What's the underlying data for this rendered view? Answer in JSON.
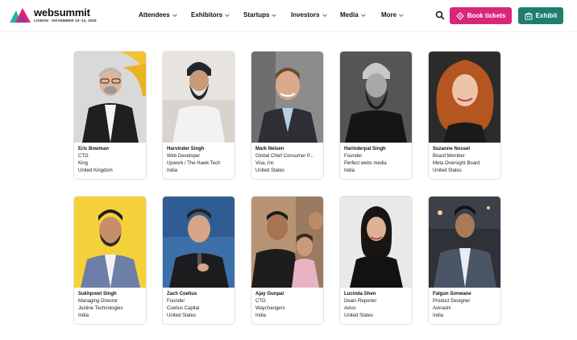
{
  "header": {
    "logo_text": "websummit",
    "logo_sub": "LISBON · NOVEMBER 10–13, 2025",
    "nav": [
      {
        "label": "Attendees",
        "has_dropdown": true
      },
      {
        "label": "Exhibitors",
        "has_dropdown": true
      },
      {
        "label": "Startups",
        "has_dropdown": true
      },
      {
        "label": "Investors",
        "has_dropdown": true
      },
      {
        "label": "Media",
        "has_dropdown": true
      },
      {
        "label": "More",
        "has_dropdown": true
      }
    ],
    "search_icon": "search-icon",
    "book_label": "Book tickets",
    "exhibit_label": "Exhibit",
    "colors": {
      "book": "#d9267a",
      "exhibit": "#1e7f6f",
      "chevron": "#1e7f6f"
    }
  },
  "speakers": [
    {
      "name": "Eric Bowman",
      "title": "CTO",
      "company": "King",
      "country": "United Kingdom"
    },
    {
      "name": "Harvinder Singh",
      "title": "Web Developer",
      "company": "Upwork / The Hawk Tech",
      "country": "India"
    },
    {
      "name": "Mark Nelsen",
      "title": "Global Chief Consumer P...",
      "company": "Visa, Inc",
      "country": "United States"
    },
    {
      "name": "Harinderpal Singh",
      "title": "Founder",
      "company": "Perfect webs media",
      "country": "India"
    },
    {
      "name": "Suzanne Nossel",
      "title": "Board Member",
      "company": "Meta Oversight Board",
      "country": "United States"
    },
    {
      "name": "Sukhpreet Singh",
      "title": "Managing Director",
      "company": "Justine Technologies",
      "country": "India"
    },
    {
      "name": "Zach Coelius",
      "title": "Founder",
      "company": "Coelius Capital",
      "country": "United States"
    },
    {
      "name": "Ajay Gunpal",
      "title": "CTO",
      "company": "Waychangers",
      "country": "India"
    },
    {
      "name": "Lucinda Shen",
      "title": "Deals Reporter",
      "company": "Axios",
      "country": "United States"
    },
    {
      "name": "Falgun Sonwane",
      "title": "Product Designer",
      "company": "Avinashi",
      "country": "India"
    }
  ]
}
